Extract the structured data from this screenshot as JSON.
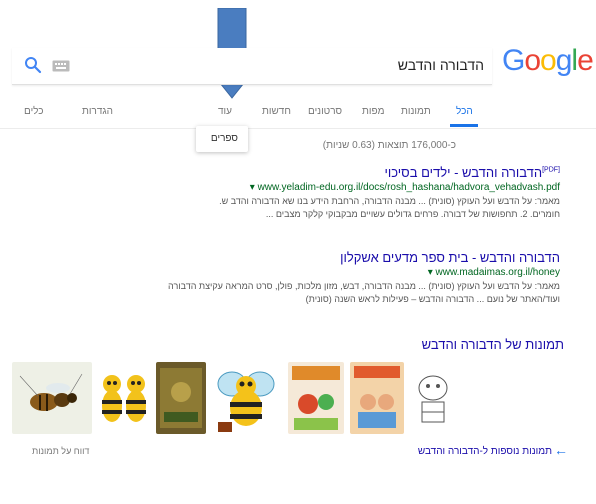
{
  "search": {
    "query": "הדבורה והדבש"
  },
  "logo": {
    "letters": [
      "G",
      "o",
      "o",
      "g",
      "l",
      "e"
    ],
    "colors": [
      "#4285F4",
      "#EA4335",
      "#FBBC05",
      "#4285F4",
      "#34A853",
      "#EA4335"
    ]
  },
  "nav": {
    "tabs": [
      "הכל",
      "תמונות",
      "מפות",
      "סרטונים",
      "חדשות",
      "עוד"
    ],
    "settings": "הגדרות",
    "tools": "כלים",
    "active_color": "#1a73e8"
  },
  "dropdown": {
    "item": "ספרים"
  },
  "stats": "כ-176,000 תוצאות (0.63 שניות)",
  "results": [
    {
      "badge": "[PDF]",
      "title": "הדבורה והדבש - ילדים בסיכוי",
      "url": "www.yeladim-edu.org.il/docs/rosh_hashana/hadvora_vehadvash.pdf",
      "snippet1": "מאמר: על הדבש ועל העוקץ (סונית) ... מבנה הדבורה, הרחבת הידע בנו שא הדבורה והדב ש.",
      "snippet2": "חומרים. 2. תחפושות של דבורה. פרחים גדולים עשויים מבקבוקי קלקר מצבים ..."
    },
    {
      "title": "הדבורה והדבש - בית ספר מדעים אשקלון",
      "url": "www.madaimas.org.il/honey",
      "snippet1": "מאמר: על הדבש ועל העוקץ (סונית) ... מבנה הדבורה, דבש, מזון מלכות, פולן, סרט המראה עקיצת הדבורה",
      "snippet2": "ועוד/האתר של נועם ... הדבורה והדבש – פעילות לראש השנה (סונית)"
    }
  ],
  "images": {
    "title": "תמונות של הדבורה והדבש",
    "more": "תמונות נוספות ל-הדבורה והדבש",
    "report": "דווח על תמונות"
  },
  "colors": {
    "link": "#1a0dab",
    "url": "#006621",
    "arrow": "#4a7dc0"
  }
}
